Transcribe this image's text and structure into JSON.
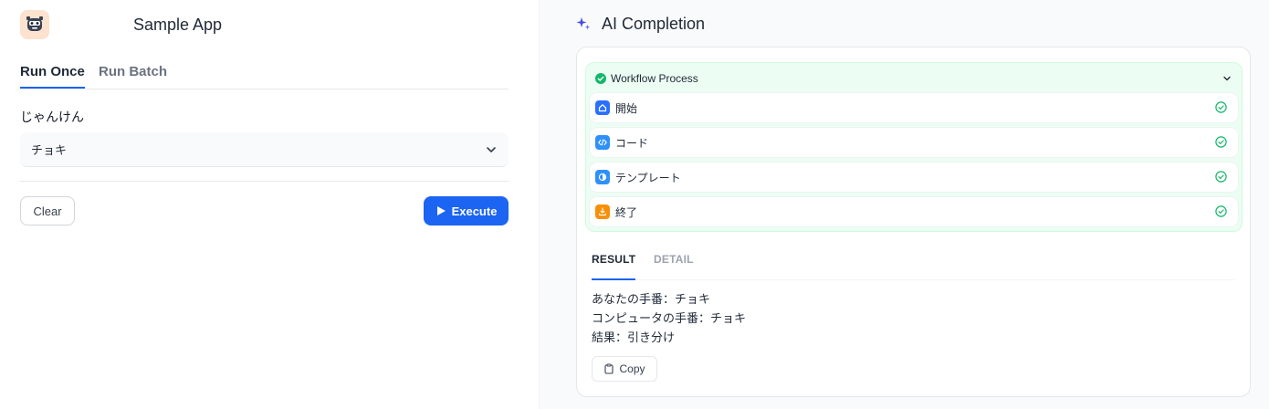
{
  "app": {
    "name": "Sample App"
  },
  "tabs": [
    {
      "label": "Run Once",
      "active": true
    },
    {
      "label": "Run Batch",
      "active": false
    }
  ],
  "form": {
    "field_label": "じゃんけん",
    "select_value": "チョキ"
  },
  "actions": {
    "clear_label": "Clear",
    "execute_label": "Execute"
  },
  "completion": {
    "title": "AI Completion",
    "workflow": {
      "title": "Workflow Process",
      "status": "success",
      "steps": [
        {
          "label": "開始",
          "icon": "home-icon",
          "color": "#2970ff"
        },
        {
          "label": "コード",
          "icon": "code-icon",
          "color": "#2e90fa"
        },
        {
          "label": "テンプレート",
          "icon": "template-icon",
          "color": "#2e90fa"
        },
        {
          "label": "終了",
          "icon": "flag-end-icon",
          "color": "#f79009"
        }
      ]
    },
    "result_tabs": [
      {
        "label": "RESULT",
        "active": true
      },
      {
        "label": "DETAIL",
        "active": false
      }
    ],
    "result_lines": [
      "あなたの手番：チョキ",
      "コンピュータの手番：チョキ",
      "結果：引き分け"
    ],
    "copy_label": "Copy"
  },
  "colors": {
    "accent": "#1c64f2",
    "success": "#12b76a",
    "workflow_bg": "#ecfdf3"
  }
}
